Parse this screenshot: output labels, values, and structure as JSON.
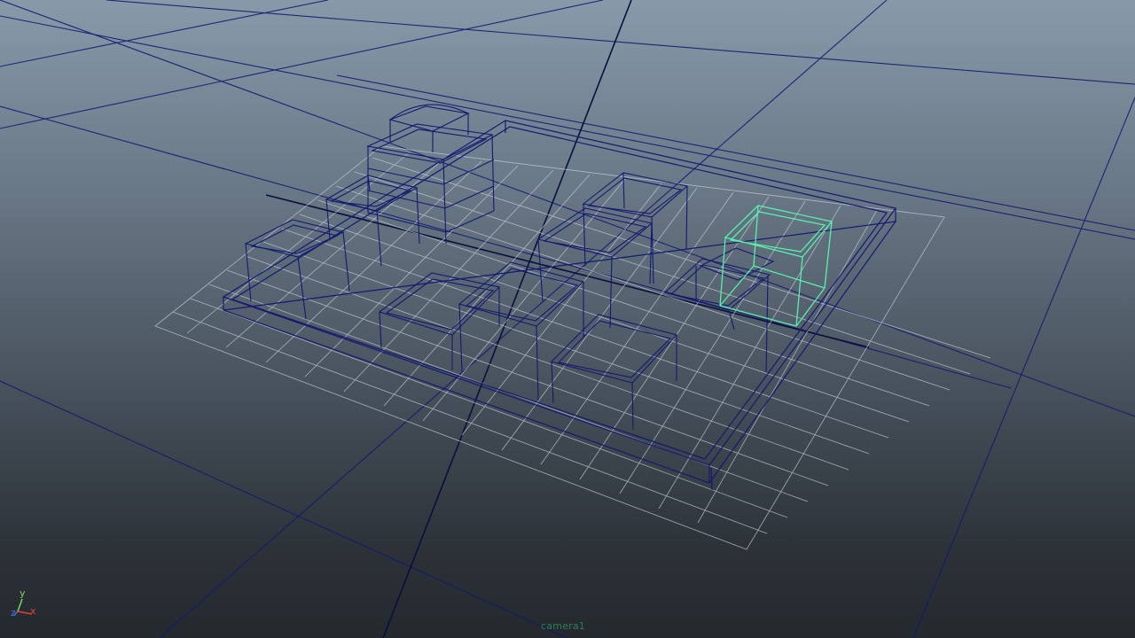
{
  "viewport": {
    "camera_name": "camera1",
    "axes": {
      "y": "y",
      "x": "x",
      "z": "z"
    },
    "colors": {
      "background_top": "#8899a9",
      "background_bottom": "#24292e",
      "world_grid": "#141a6e",
      "local_grid": "#c8d0d8",
      "wireframe": "#141a6e",
      "selected_wireframe": "#58f0b0",
      "axis_x": "#e0423b",
      "axis_y": "#7cd46a",
      "axis_z": "#4b6fe0",
      "camera_label": "#2f7d57"
    },
    "selection": {
      "selected_object": "box-right",
      "selected_count": 1
    }
  }
}
